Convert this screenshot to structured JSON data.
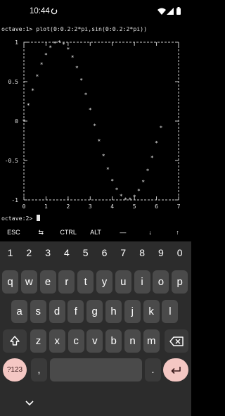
{
  "status_bar": {
    "time": "10:44",
    "icons": [
      "sync-icon",
      "wifi-icon",
      "signal-icon",
      "battery-icon"
    ]
  },
  "terminal": {
    "command_line": "octave:1> plot(0:0.2:2*pi,sin(0:0.2:2*pi))",
    "next_prompt": "octave:2> "
  },
  "chart_data": {
    "type": "scatter",
    "x": [
      0,
      0.2,
      0.4,
      0.6,
      0.8,
      1.0,
      1.2,
      1.4,
      1.6,
      1.8,
      2.0,
      2.2,
      2.4,
      2.6,
      2.8,
      3.0,
      3.2,
      3.4,
      3.6,
      3.8,
      4.0,
      4.2,
      4.4,
      4.6,
      4.8,
      5.0,
      5.2,
      5.4,
      5.6,
      5.8,
      6.0,
      6.2
    ],
    "y": [
      0,
      0.199,
      0.389,
      0.565,
      0.717,
      0.841,
      0.932,
      0.985,
      1.0,
      0.974,
      0.909,
      0.808,
      0.675,
      0.516,
      0.335,
      0.141,
      -0.058,
      -0.256,
      -0.443,
      -0.612,
      -0.757,
      -0.872,
      -0.952,
      -0.994,
      -0.996,
      -0.959,
      -0.883,
      -0.773,
      -0.631,
      -0.465,
      -0.279,
      -0.083
    ],
    "marker": "*",
    "xlim": [
      0,
      7
    ],
    "ylim": [
      -1,
      1
    ],
    "x_ticks": [
      "0",
      "1",
      "2",
      "3",
      "4",
      "5",
      "6",
      "7"
    ],
    "y_ticks": [
      "1",
      "0.5",
      "0",
      "-0.5",
      "-1"
    ],
    "grid": false,
    "frame": "dashed",
    "colors": {
      "frame": "#cfcfcf",
      "points": "#e8e8e8"
    }
  },
  "extra_keys": [
    "ESC",
    "⇆",
    "CTRL",
    "ALT",
    "—",
    "↓",
    "↑"
  ],
  "keyboard": {
    "numbers": [
      "1",
      "2",
      "3",
      "4",
      "5",
      "6",
      "7",
      "8",
      "9",
      "0"
    ],
    "row1": [
      "q",
      "w",
      "e",
      "r",
      "t",
      "y",
      "u",
      "i",
      "o",
      "p"
    ],
    "row2": [
      "a",
      "s",
      "d",
      "f",
      "g",
      "h",
      "j",
      "k",
      "l"
    ],
    "row3": [
      "z",
      "x",
      "c",
      "v",
      "b",
      "n",
      "m"
    ],
    "symbols_label": "?123",
    "comma": ",",
    "period": ".",
    "colors": {
      "background": "#2c2c2c",
      "key": "#4a4a4a",
      "accent": "#f4c7c3"
    }
  }
}
